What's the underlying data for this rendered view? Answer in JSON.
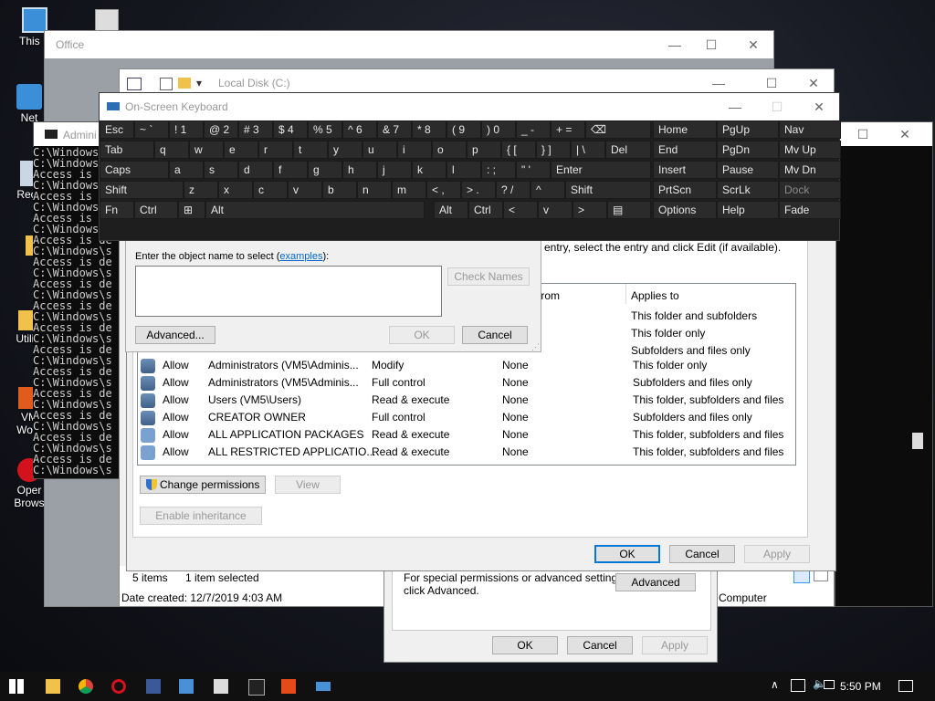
{
  "desktop": {
    "icons": [
      {
        "label": "This P",
        "icon": "computer-icon"
      },
      {
        "label": "Net",
        "icon": "network-icon"
      },
      {
        "label": "Recy",
        "icon": "recycle-bin-icon"
      },
      {
        "label": "V",
        "icon": "folder-icon"
      },
      {
        "label": "Utility",
        "icon": "folder-icon"
      },
      {
        "label": "VM",
        "icon": "vmware-icon"
      },
      {
        "label": "Work",
        "icon": "vmware-icon"
      },
      {
        "label": "Oper",
        "icon": "opera-icon"
      },
      {
        "label": "Brows",
        "icon": "opera-icon"
      }
    ]
  },
  "office_window": {
    "title": "Office"
  },
  "explorer_window": {
    "title": "Local Disk (C:)",
    "items_count": "5 items",
    "selected": "1 item selected",
    "date_created": "Date created: 12/7/2019 4:03 AM",
    "computer": "Computer"
  },
  "osk": {
    "title": "On-Screen Keyboard",
    "rows": [
      [
        "Esc",
        "~ `",
        "! 1",
        "@ 2",
        "# 3",
        "$ 4",
        "% 5",
        "^ 6",
        "& 7",
        "* 8",
        "( 9",
        ") 0",
        "_ -",
        "+ =",
        "⌫",
        "Home",
        "PgUp",
        "Nav"
      ],
      [
        "Tab",
        "q",
        "w",
        "e",
        "r",
        "t",
        "y",
        "u",
        "i",
        "o",
        "p",
        "{ [",
        "} ]",
        "| \\",
        "Del",
        "End",
        "PgDn",
        "Mv Up"
      ],
      [
        "Caps",
        "a",
        "s",
        "d",
        "f",
        "g",
        "h",
        "j",
        "k",
        "l",
        ": ;",
        "\" '",
        "Enter",
        "Insert",
        "Pause",
        "Mv Dn"
      ],
      [
        "Shift",
        "z",
        "x",
        "c",
        "v",
        "b",
        "n",
        "m",
        "< ,",
        "> .",
        "? /",
        "^",
        "Shift",
        "PrtScn",
        "ScrLk",
        "Dock"
      ],
      [
        "Fn",
        "Ctrl",
        "⊞",
        "Alt",
        "Alt",
        "Ctrl",
        "<",
        "v",
        ">",
        "▤",
        "Options",
        "Help",
        "Fade"
      ]
    ]
  },
  "console": {
    "title": "Admini",
    "lines": [
      "C:\\Windows",
      "C:\\Windows",
      "Access is",
      "C:\\Windows",
      "Access is",
      "C:\\Windows",
      "Access is",
      "C:\\Windows",
      "Access is de",
      "C:\\Windows\\s",
      "Access is de",
      "C:\\Windows\\s",
      "Access is de",
      "C:\\Windows\\s",
      "Access is de",
      "C:\\Windows\\s",
      "Access is de",
      "C:\\Windows\\s",
      "Access is de",
      "C:\\Windows\\s",
      "Access is de",
      "C:\\Windows\\s",
      "Access is de",
      "C:\\Windows\\s",
      "Access is de",
      "C:\\Windows\\s",
      "Access is de",
      "C:\\Windows\\s",
      "Access is de",
      "",
      "C:\\Windows\\s"
    ]
  },
  "select_dialog": {
    "prompt": "Enter the object name to select (",
    "examples": "examples",
    "prompt_end": "):",
    "check_names": "Check Names",
    "advanced": "Advanced...",
    "ok": "OK",
    "cancel": "Cancel"
  },
  "security_dialog": {
    "hint": "entry, select the entry and click Edit (if available).",
    "columns": {
      "inherited": "d from",
      "applies": "Applies to"
    },
    "top_rows": [
      "This folder and subfolders",
      "This folder only",
      "Subfolders and files only"
    ],
    "rows": [
      {
        "type": "Allow",
        "principal": "Administrators (VM5\\Adminis...",
        "access": "Modify",
        "inherited": "None",
        "applies": "This folder only",
        "icon": "users-icon"
      },
      {
        "type": "Allow",
        "principal": "Administrators (VM5\\Adminis...",
        "access": "Full control",
        "inherited": "None",
        "applies": "Subfolders and files only",
        "icon": "users-icon"
      },
      {
        "type": "Allow",
        "principal": "Users (VM5\\Users)",
        "access": "Read & execute",
        "inherited": "None",
        "applies": "This folder, subfolders and files",
        "icon": "users-icon"
      },
      {
        "type": "Allow",
        "principal": "CREATOR OWNER",
        "access": "Full control",
        "inherited": "None",
        "applies": "Subfolders and files only",
        "icon": "users-icon"
      },
      {
        "type": "Allow",
        "principal": "ALL APPLICATION PACKAGES",
        "access": "Read & execute",
        "inherited": "None",
        "applies": "This folder, subfolders and files",
        "icon": "package-icon"
      },
      {
        "type": "Allow",
        "principal": "ALL RESTRICTED APPLICATIO...",
        "access": "Read & execute",
        "inherited": "None",
        "applies": "This folder, subfolders and files",
        "icon": "package-icon"
      }
    ],
    "change_permissions": "Change permissions",
    "view": "View",
    "enable_inheritance": "Enable inheritance",
    "ok": "OK",
    "cancel": "Cancel",
    "apply": "Apply"
  },
  "properties_dialog": {
    "special_text_1": "For special permissions or advanced settings,",
    "special_text_2": "click Advanced.",
    "advanced": "Advanced",
    "ok": "OK",
    "cancel": "Cancel",
    "apply": "Apply"
  },
  "taskbar": {
    "time": "5:50 PM"
  }
}
